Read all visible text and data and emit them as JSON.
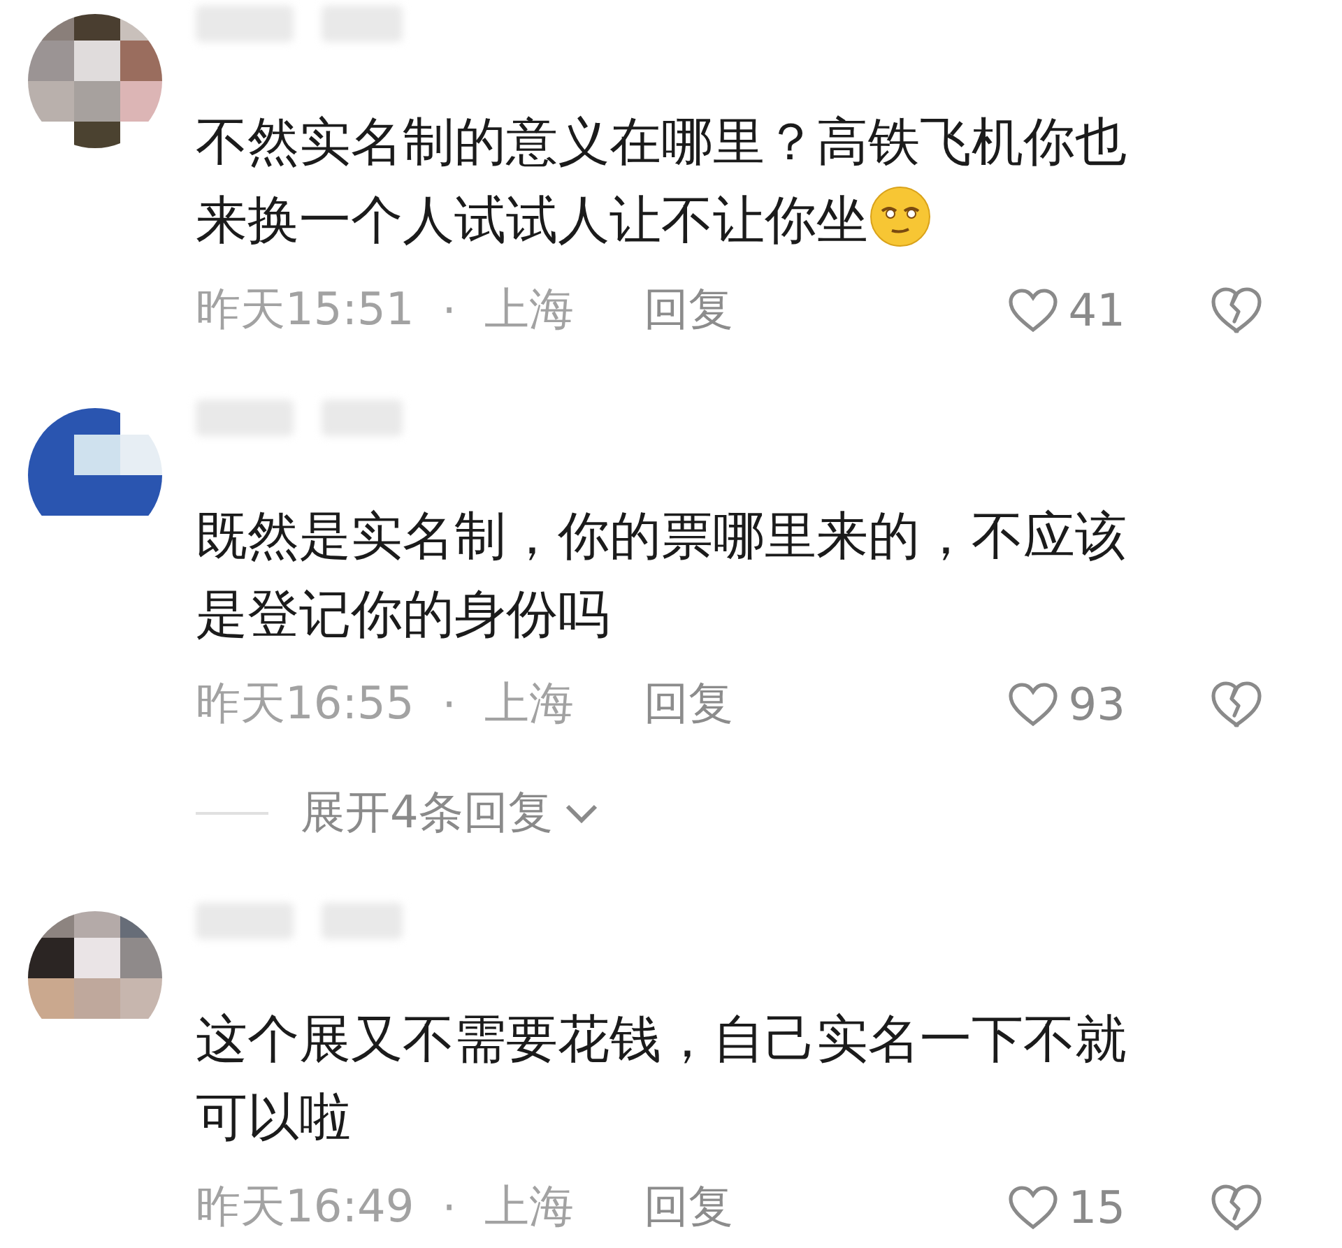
{
  "comments": [
    {
      "text": "不然实名制的意义在哪里？高铁飞机你也来换一个人试试人让不让你坐",
      "trailing_emoji": true,
      "time": "昨天15:51",
      "separator": "·",
      "location": "上海",
      "reply": "回复",
      "likes": "41"
    },
    {
      "text": "既然是实名制，你的票哪里来的，不应该是登记你的身份吗",
      "trailing_emoji": false,
      "time": "昨天16:55",
      "separator": "·",
      "location": "上海",
      "reply": "回复",
      "likes": "93",
      "more_replies": "展开4条回复"
    },
    {
      "text": "这个展又不需要花钱，自己实名一下不就可以啦",
      "trailing_emoji": false,
      "time": "昨天16:49",
      "separator": "·",
      "location": "上海",
      "reply": "回复",
      "likes": "15"
    }
  ]
}
